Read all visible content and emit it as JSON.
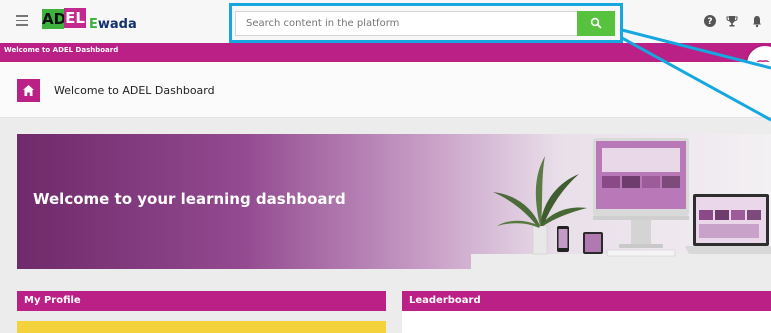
{
  "header": {
    "logo_left": "AD",
    "logo_right": "EL",
    "logo_partner_prefix": "E",
    "logo_partner": "wada",
    "search_placeholder": "Search content in the platform",
    "icons": [
      "menu-icon",
      "search-icon",
      "help-icon",
      "trophy-icon",
      "bell-icon"
    ]
  },
  "strip": {
    "label": "Welcome to ADEL Dashboard"
  },
  "breadcrumb": {
    "title": "Welcome to ADEL Dashboard",
    "icon": "home-icon"
  },
  "banner": {
    "title": "Welcome to your learning dashboard"
  },
  "cards": {
    "profile_title": "My Profile",
    "leaderboard_title": "Leaderboard"
  },
  "colors": {
    "brand_magenta": "#bb2086",
    "brand_green": "#3eb13e",
    "search_green": "#56c23d",
    "highlight_blue": "#16a7e0",
    "profile_yellow": "#f4d23b"
  }
}
